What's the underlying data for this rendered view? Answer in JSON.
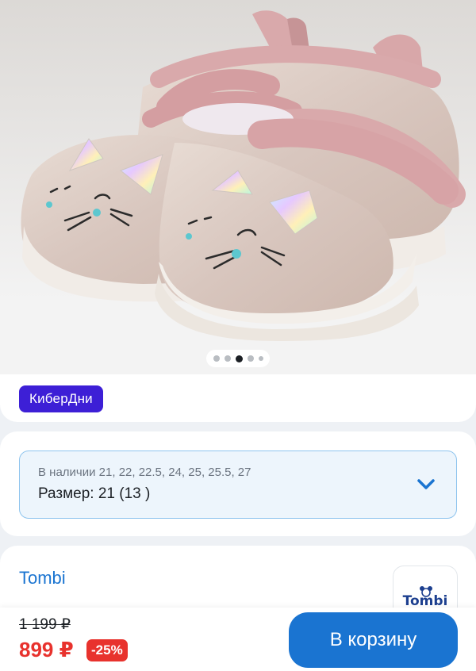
{
  "product": {
    "image_alt": "shoes-product-photo",
    "carousel": {
      "count": 5,
      "active_index": 2
    }
  },
  "promo": {
    "badge": "КиберДни"
  },
  "size": {
    "availability": "В наличии 21, 22, 22.5, 24, 25, 25.5, 27",
    "selected": "Размер: 21 (13 )",
    "icon": "chevron-down-icon"
  },
  "brand": {
    "name": "Tombi",
    "logo_text": "Tombi"
  },
  "pricing": {
    "old_price": "1 199 ₽",
    "new_price": "899 ₽",
    "discount": "-25%"
  },
  "actions": {
    "add_to_cart": "В корзину"
  },
  "colors": {
    "accent": "#1a74d1",
    "promo": "#3d1fd6",
    "sale": "#e8322d"
  }
}
